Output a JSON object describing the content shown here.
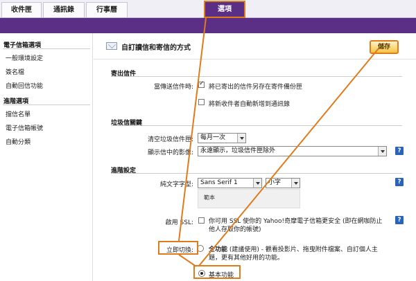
{
  "tabs": [
    {
      "label": "收件匣"
    },
    {
      "label": "通訊錄"
    },
    {
      "label": "行事曆"
    },
    {
      "label": "選項"
    }
  ],
  "sidebar": {
    "section1_title": "電子信箱選項",
    "section1_items": [
      "一般環境設定",
      "簽名檔",
      "自動回信功能"
    ],
    "section2_title": "進階選項",
    "section2_items": [
      "擋信名單",
      "電子信箱帳號",
      "自動分類"
    ]
  },
  "main": {
    "title": "自訂讀信和寄信的方式",
    "save_label": "儲存",
    "sending": {
      "heading": "寄出信件",
      "when_sending_label": "當傳送信件時:",
      "save_sent_option": "將已寄出的信件另存在寄件備份匣",
      "save_sent_checked": true,
      "add_recipients_option": "將新收件者自動新增到通訊錄",
      "add_recipients_checked": false
    },
    "spam": {
      "heading": "垃圾信關鍵",
      "empty_label": "清空垃圾信件匣:",
      "empty_value": "每月一次",
      "images_label": "顯示信中的影像:",
      "images_value": "永遠顯示，垃圾信件匣除外"
    },
    "advanced": {
      "heading": "進階設定",
      "font_label": "純文字字型:",
      "font_value": "Sans Serif 1",
      "size_value": "小字",
      "sample_text": "範本",
      "ssl_label": "啟用 SSL:",
      "ssl_text_line1": "你可用 SSL 使你的 Yahoo!奇摩電子信箱更安全 (即在網咖防止",
      "ssl_text_line2": "他人存取你的帳號)",
      "ssl_checked": false,
      "switch_label": "立即切換:",
      "full_feature_title": "全功能",
      "full_feature_desc_line1": " (建議使用) - 觀看投影片、拖曳附件檔案、自訂個人主",
      "full_feature_desc_line2": "題，更有其他好用的功能。",
      "full_feature_selected": false,
      "basic_label": "基本功能",
      "basic_selected": true
    },
    "help_glyph": "?"
  },
  "colors": {
    "brand_purple": "#5c2f86",
    "highlight_orange": "#e07b1a",
    "help_blue": "#2a63b8"
  }
}
